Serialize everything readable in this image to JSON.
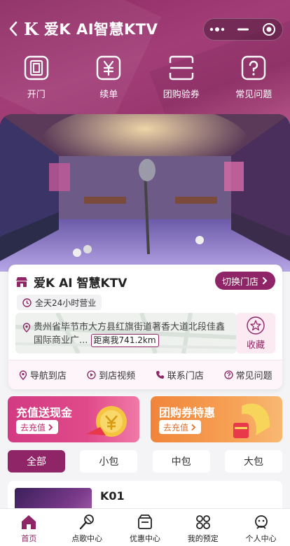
{
  "nav": {
    "title": "爱K AI智慧KTV",
    "logo_text": "K"
  },
  "quick_actions": [
    {
      "label": "开门",
      "icon": "door-icon"
    },
    {
      "label": "续单",
      "icon": "yen-icon"
    },
    {
      "label": "团购验券",
      "icon": "scan-icon"
    },
    {
      "label": "常见问题",
      "icon": "question-icon"
    }
  ],
  "store": {
    "name": "爱K AI 智慧KTV",
    "switch_label": "切换门店",
    "hours": "全天24小时营业",
    "address": "贵州省毕节市大方县红旗街道著香大道北段佳鑫国际商业广...",
    "distance": "距离我741.2km",
    "favorite_label": "收藏"
  },
  "store_actions": [
    {
      "label": "导航到店",
      "icon": "navigation-icon"
    },
    {
      "label": "到店视频",
      "icon": "video-icon"
    },
    {
      "label": "联系门店",
      "icon": "phone-icon"
    },
    {
      "label": "常见问题",
      "icon": "question-icon"
    }
  ],
  "promos": [
    {
      "title": "充值送现金",
      "button": "去充值"
    },
    {
      "title": "团购券特惠",
      "button": "去充值"
    }
  ],
  "filters": [
    "全部",
    "小包",
    "中包",
    "大包"
  ],
  "rooms": [
    {
      "name": "K01"
    }
  ],
  "tabbar": [
    {
      "label": "首页",
      "icon": "home-icon"
    },
    {
      "label": "点歌中心",
      "icon": "microphone-icon"
    },
    {
      "label": "优惠中心",
      "icon": "coupon-icon"
    },
    {
      "label": "我的预定",
      "icon": "grid-icon"
    },
    {
      "label": "个人中心",
      "icon": "user-icon"
    }
  ],
  "colors": {
    "brand": "#8f2566",
    "header": "#9a3770",
    "promo_pink": "#d23a82",
    "promo_orange": "#f0853a"
  }
}
